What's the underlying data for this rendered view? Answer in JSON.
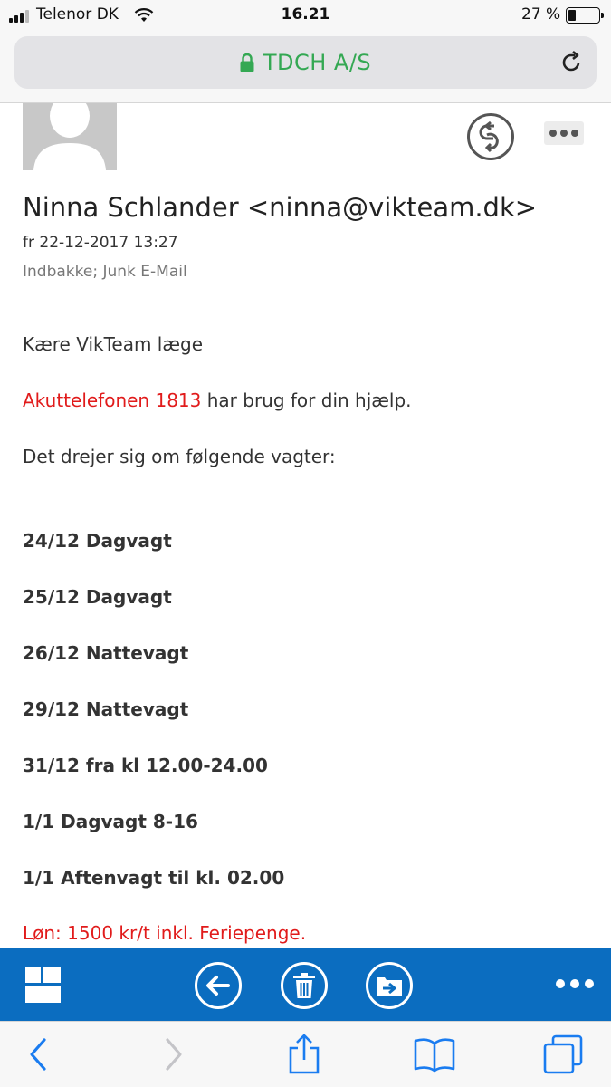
{
  "status_bar": {
    "carrier": "Telenor DK",
    "time": "16.21",
    "battery": "27 %",
    "battery_level": 0.27
  },
  "browser": {
    "site_name": "TDCH A/S"
  },
  "email": {
    "sender": "Ninna Schlander <ninna@vikteam.dk>",
    "date": "fr 22-12-2017 13:27",
    "folders": "Indbakke; Junk E-Mail",
    "greeting": "Kære VikTeam læge",
    "request_highlight": "Akuttelefonen 1813",
    "request_rest": " har brug for din hjælp.",
    "shifts_intro": "Det drejer sig om følgende vagter:",
    "shifts": [
      "24/12 Dagvagt",
      "25/12 Dagvagt",
      "26/12 Nattevagt",
      "29/12 Nattevagt",
      "31/12 fra kl 12.00-24.00",
      "1/1 Dagvagt 8-16",
      "1/1 Aftenvagt til kl. 02.00"
    ],
    "salary": "Løn: 1500 kr/t inkl. Feriepenge."
  },
  "icons": {
    "reply": "reply-icon",
    "more": "more-icon",
    "tiles": "tiles-icon",
    "back": "arrow-left-icon",
    "delete": "trash-icon",
    "move": "move-to-folder-icon",
    "nav_back": "chevron-left-icon",
    "nav_forward": "chevron-right-icon",
    "share": "share-icon",
    "bookmarks": "book-icon",
    "tabs": "tabs-icon"
  },
  "colors": {
    "toolbar": "#0b6dc0",
    "highlight_red": "#e11b1b",
    "secure_green": "#34a853",
    "safari_blue": "#1a7cf0"
  }
}
